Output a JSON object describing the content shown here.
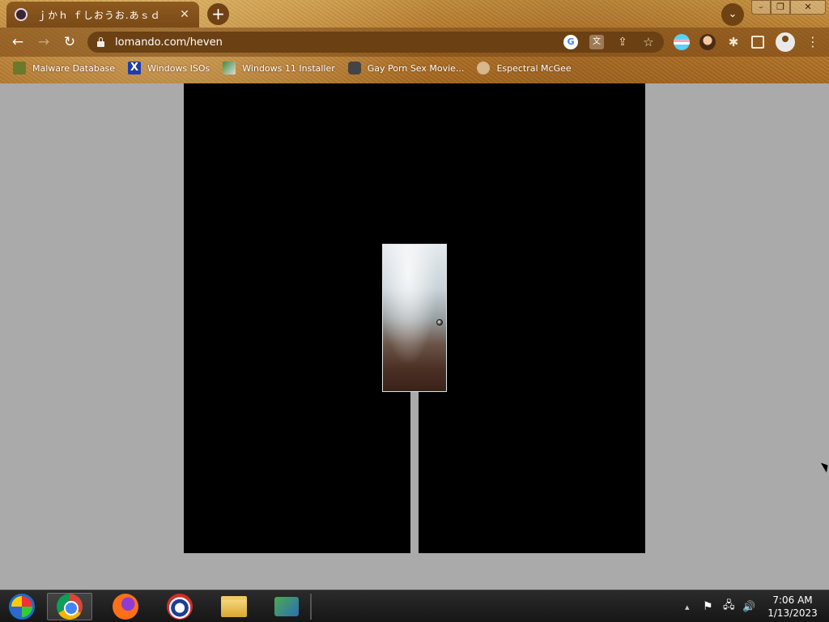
{
  "browser": {
    "tab": {
      "title": "ｊかｈ ｆしおうお.あｓｄ",
      "close_icon": "close-icon",
      "favicon": "anime-avatar-icon"
    },
    "new_tab_label": "+",
    "tab_search_glyph": "⌄",
    "window_controls": {
      "minimize": "–",
      "maximize": "❐",
      "close": "✕"
    },
    "nav": {
      "back": "←",
      "forward": "→",
      "reload": "↻"
    },
    "url": "lomando.com/heven",
    "omnibox_icons": {
      "google": "G",
      "translate": "文",
      "share": "⇪",
      "bookmark": "☆"
    },
    "extensions": {
      "puzzle": "✱",
      "menu": "⋮"
    },
    "bookmarks": [
      {
        "label": "Malware Database",
        "icon": "malware-icon"
      },
      {
        "label": "Windows ISOs",
        "icon": "x-logo-icon"
      },
      {
        "label": "Windows 11 Installer",
        "icon": "installer-icon"
      },
      {
        "label": "Gay Porn Sex Movie...",
        "icon": "movie-icon"
      },
      {
        "label": "Espectral McGee",
        "icon": "face-icon"
      }
    ]
  },
  "page": {
    "background": "#aaaaaa",
    "stage_color": "#000000"
  },
  "taskbar": {
    "apps": [
      "start-orb",
      "chrome",
      "firefox",
      "obama-logo",
      "file-explorer",
      "network-app"
    ],
    "tray": {
      "chevron": "▴",
      "flag": "⚑",
      "network": "🖧",
      "volume": "🔊"
    },
    "clock": {
      "time": "7:06 AM",
      "date": "1/13/2023"
    }
  }
}
